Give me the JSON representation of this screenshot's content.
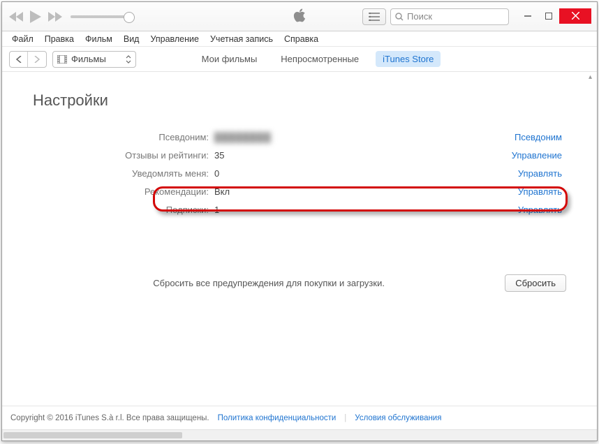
{
  "search": {
    "placeholder": "Поиск"
  },
  "menubar": [
    "Файл",
    "Правка",
    "Фильм",
    "Вид",
    "Управление",
    "Учетная запись",
    "Справка"
  ],
  "media_selector": "Фильмы",
  "tabs": [
    {
      "label": "Мои фильмы",
      "active": false
    },
    {
      "label": "Непросмотренные",
      "active": false
    },
    {
      "label": "iTunes Store",
      "active": true
    }
  ],
  "page_title": "Настройки",
  "rows": [
    {
      "label": "Псевдоним:",
      "value": "████████",
      "action": "Псевдоним",
      "blur": true
    },
    {
      "label": "Отзывы и рейтинги:",
      "value": "35",
      "action": "Управление"
    },
    {
      "label": "Уведомлять меня:",
      "value": "0",
      "action": "Управлять"
    },
    {
      "label": "Рекомендации:",
      "value": "Вкл",
      "action": "Управлять"
    },
    {
      "label": "Подписки:",
      "value": "1",
      "action": "Управлять"
    }
  ],
  "reset": {
    "text": "Сбросить все предупреждения для покупки и загрузки.",
    "button": "Сбросить"
  },
  "footer": {
    "copyright": "Copyright © 2016 iTunes S.à r.l. Все права защищены.",
    "privacy": "Политика конфиденциальности",
    "terms": "Условия обслуживания"
  }
}
